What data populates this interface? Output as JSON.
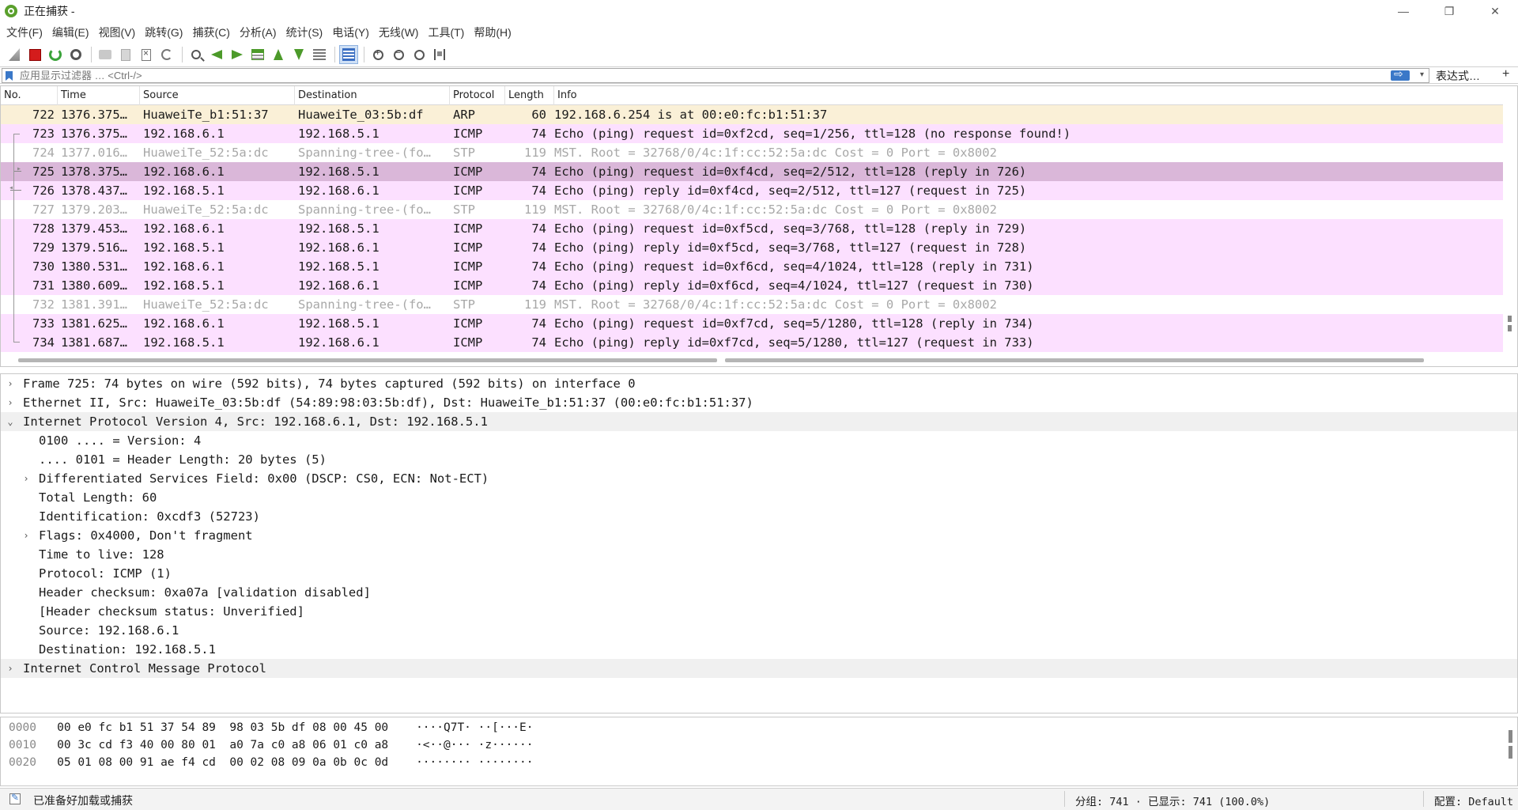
{
  "window": {
    "title": "正在捕获 -",
    "controls": {
      "minimize": "—",
      "restore": "❐",
      "close": "✕"
    }
  },
  "menu": [
    "文件(F)",
    "编辑(E)",
    "视图(V)",
    "跳转(G)",
    "捕获(C)",
    "分析(A)",
    "统计(S)",
    "电话(Y)",
    "无线(W)",
    "工具(T)",
    "帮助(H)"
  ],
  "toolbar": {
    "icons": [
      "shark-fin-icon",
      "stop-capture-icon",
      "restart-capture-icon",
      "capture-options-icon",
      "open-file-icon",
      "save-file-icon",
      "close-file-icon",
      "reload-file-icon",
      "find-packet-icon",
      "go-back-icon",
      "go-forward-icon",
      "go-to-packet-icon",
      "go-first-icon",
      "go-last-icon",
      "autoscroll-icon",
      "colorize-icon",
      "zoom-in-icon",
      "zoom-out-icon",
      "zoom-reset-icon",
      "resize-columns-icon"
    ]
  },
  "filter": {
    "placeholder": "应用显示过滤器 … <Ctrl-/>",
    "expression_label": "表达式…",
    "add_label": "+"
  },
  "packet_list": {
    "columns": [
      "No.",
      "Time",
      "Source",
      "Destination",
      "Protocol",
      "Length",
      "Info"
    ],
    "rows": [
      {
        "no": "722",
        "time": "1376.375…",
        "src": "HuaweiTe_b1:51:37",
        "dst": "HuaweiTe_03:5b:df",
        "proto": "ARP",
        "len": "60",
        "info": "192.168.6.254 is at 00:e0:fc:b1:51:37",
        "kind": "arp",
        "rel": ""
      },
      {
        "no": "723",
        "time": "1376.375…",
        "src": "192.168.6.1",
        "dst": "192.168.5.1",
        "proto": "ICMP",
        "len": "74",
        "info": "Echo (ping) request  id=0xf2cd, seq=1/256, ttl=128 (no response found!)",
        "kind": "icmp",
        "rel": "start"
      },
      {
        "no": "724",
        "time": "1377.016…",
        "src": "HuaweiTe_52:5a:dc",
        "dst": "Spanning-tree-(fo…",
        "proto": "STP",
        "len": "119",
        "info": "MST. Root = 32768/0/4c:1f:cc:52:5a:dc  Cost = 0  Port = 0x8002",
        "kind": "stp",
        "rel": "line"
      },
      {
        "no": "725",
        "time": "1378.375…",
        "src": "192.168.6.1",
        "dst": "192.168.5.1",
        "proto": "ICMP",
        "len": "74",
        "info": "Echo (ping) request  id=0xf4cd, seq=2/512, ttl=128 (reply in 726)",
        "kind": "sel",
        "rel": "req"
      },
      {
        "no": "726",
        "time": "1378.437…",
        "src": "192.168.5.1",
        "dst": "192.168.6.1",
        "proto": "ICMP",
        "len": "74",
        "info": "Echo (ping) reply    id=0xf4cd, seq=2/512, ttl=127 (request in 725)",
        "kind": "icmp",
        "rel": "rep"
      },
      {
        "no": "727",
        "time": "1379.203…",
        "src": "HuaweiTe_52:5a:dc",
        "dst": "Spanning-tree-(fo…",
        "proto": "STP",
        "len": "119",
        "info": "MST. Root = 32768/0/4c:1f:cc:52:5a:dc  Cost = 0  Port = 0x8002",
        "kind": "stp",
        "rel": "line"
      },
      {
        "no": "728",
        "time": "1379.453…",
        "src": "192.168.6.1",
        "dst": "192.168.5.1",
        "proto": "ICMP",
        "len": "74",
        "info": "Echo (ping) request  id=0xf5cd, seq=3/768, ttl=128 (reply in 729)",
        "kind": "icmp",
        "rel": "line"
      },
      {
        "no": "729",
        "time": "1379.516…",
        "src": "192.168.5.1",
        "dst": "192.168.6.1",
        "proto": "ICMP",
        "len": "74",
        "info": "Echo (ping) reply    id=0xf5cd, seq=3/768, ttl=127 (request in 728)",
        "kind": "icmp",
        "rel": "line"
      },
      {
        "no": "730",
        "time": "1380.531…",
        "src": "192.168.6.1",
        "dst": "192.168.5.1",
        "proto": "ICMP",
        "len": "74",
        "info": "Echo (ping) request  id=0xf6cd, seq=4/1024, ttl=128 (reply in 731)",
        "kind": "icmp",
        "rel": "line"
      },
      {
        "no": "731",
        "time": "1380.609…",
        "src": "192.168.5.1",
        "dst": "192.168.6.1",
        "proto": "ICMP",
        "len": "74",
        "info": "Echo (ping) reply    id=0xf6cd, seq=4/1024, ttl=127 (request in 730)",
        "kind": "icmp",
        "rel": "line"
      },
      {
        "no": "732",
        "time": "1381.391…",
        "src": "HuaweiTe_52:5a:dc",
        "dst": "Spanning-tree-(fo…",
        "proto": "STP",
        "len": "119",
        "info": "MST. Root = 32768/0/4c:1f:cc:52:5a:dc  Cost = 0  Port = 0x8002",
        "kind": "stp",
        "rel": "line"
      },
      {
        "no": "733",
        "time": "1381.625…",
        "src": "192.168.6.1",
        "dst": "192.168.5.1",
        "proto": "ICMP",
        "len": "74",
        "info": "Echo (ping) request  id=0xf7cd, seq=5/1280, ttl=128 (reply in 734)",
        "kind": "icmp",
        "rel": "line"
      },
      {
        "no": "734",
        "time": "1381.687…",
        "src": "192.168.5.1",
        "dst": "192.168.6.1",
        "proto": "ICMP",
        "len": "74",
        "info": "Echo (ping) reply    id=0xf7cd, seq=5/1280, ttl=127 (request in 733)",
        "kind": "icmp",
        "rel": "end"
      }
    ]
  },
  "details": [
    {
      "level": 0,
      "twisty": "collapsed",
      "text": "Frame 725: 74 bytes on wire (592 bits), 74 bytes captured (592 bits) on interface 0",
      "hl": false
    },
    {
      "level": 0,
      "twisty": "collapsed",
      "text": "Ethernet II, Src: HuaweiTe_03:5b:df (54:89:98:03:5b:df), Dst: HuaweiTe_b1:51:37 (00:e0:fc:b1:51:37)",
      "hl": false
    },
    {
      "level": 0,
      "twisty": "expanded",
      "text": "Internet Protocol Version 4, Src: 192.168.6.1, Dst: 192.168.5.1",
      "hl": true
    },
    {
      "level": 1,
      "twisty": "none",
      "text": "0100 .... = Version: 4",
      "hl": false
    },
    {
      "level": 1,
      "twisty": "none",
      "text": ".... 0101 = Header Length: 20 bytes (5)",
      "hl": false
    },
    {
      "level": 1,
      "twisty": "collapsed",
      "text": "Differentiated Services Field: 0x00 (DSCP: CS0, ECN: Not-ECT)",
      "hl": false
    },
    {
      "level": 1,
      "twisty": "none",
      "text": "Total Length: 60",
      "hl": false
    },
    {
      "level": 1,
      "twisty": "none",
      "text": "Identification: 0xcdf3 (52723)",
      "hl": false
    },
    {
      "level": 1,
      "twisty": "collapsed",
      "text": "Flags: 0x4000, Don't fragment",
      "hl": false
    },
    {
      "level": 1,
      "twisty": "none",
      "text": "Time to live: 128",
      "hl": false
    },
    {
      "level": 1,
      "twisty": "none",
      "text": "Protocol: ICMP (1)",
      "hl": false
    },
    {
      "level": 1,
      "twisty": "none",
      "text": "Header checksum: 0xa07a [validation disabled]",
      "hl": false
    },
    {
      "level": 1,
      "twisty": "none",
      "text": "[Header checksum status: Unverified]",
      "hl": false
    },
    {
      "level": 1,
      "twisty": "none",
      "text": "Source: 192.168.6.1",
      "hl": false
    },
    {
      "level": 1,
      "twisty": "none",
      "text": "Destination: 192.168.5.1",
      "hl": false
    },
    {
      "level": 0,
      "twisty": "collapsed",
      "text": "Internet Control Message Protocol",
      "hl": true
    }
  ],
  "hex": [
    {
      "offset": "0000",
      "bytes": "00 e0 fc b1 51 37 54 89  98 03 5b df 08 00 45 00",
      "ascii": "····Q7T· ··[···E·"
    },
    {
      "offset": "0010",
      "bytes": "00 3c cd f3 40 00 80 01  a0 7a c0 a8 06 01 c0 a8",
      "ascii": "·<··@··· ·z······"
    },
    {
      "offset": "0020",
      "bytes": "05 01 08 00 91 ae f4 cd  00 02 08 09 0a 0b 0c 0d",
      "ascii": "········ ········"
    }
  ],
  "status": {
    "message": "已准备好加载或捕获",
    "packets": "分组: 741 · 已显示: 741 (100.0%)",
    "profile": "配置: Default"
  },
  "colors": {
    "arp_row": "#faf0d7",
    "icmp_row": "#fce0ff",
    "selected_row": "#dab7d9",
    "stp_text": "#a8a8a8"
  }
}
